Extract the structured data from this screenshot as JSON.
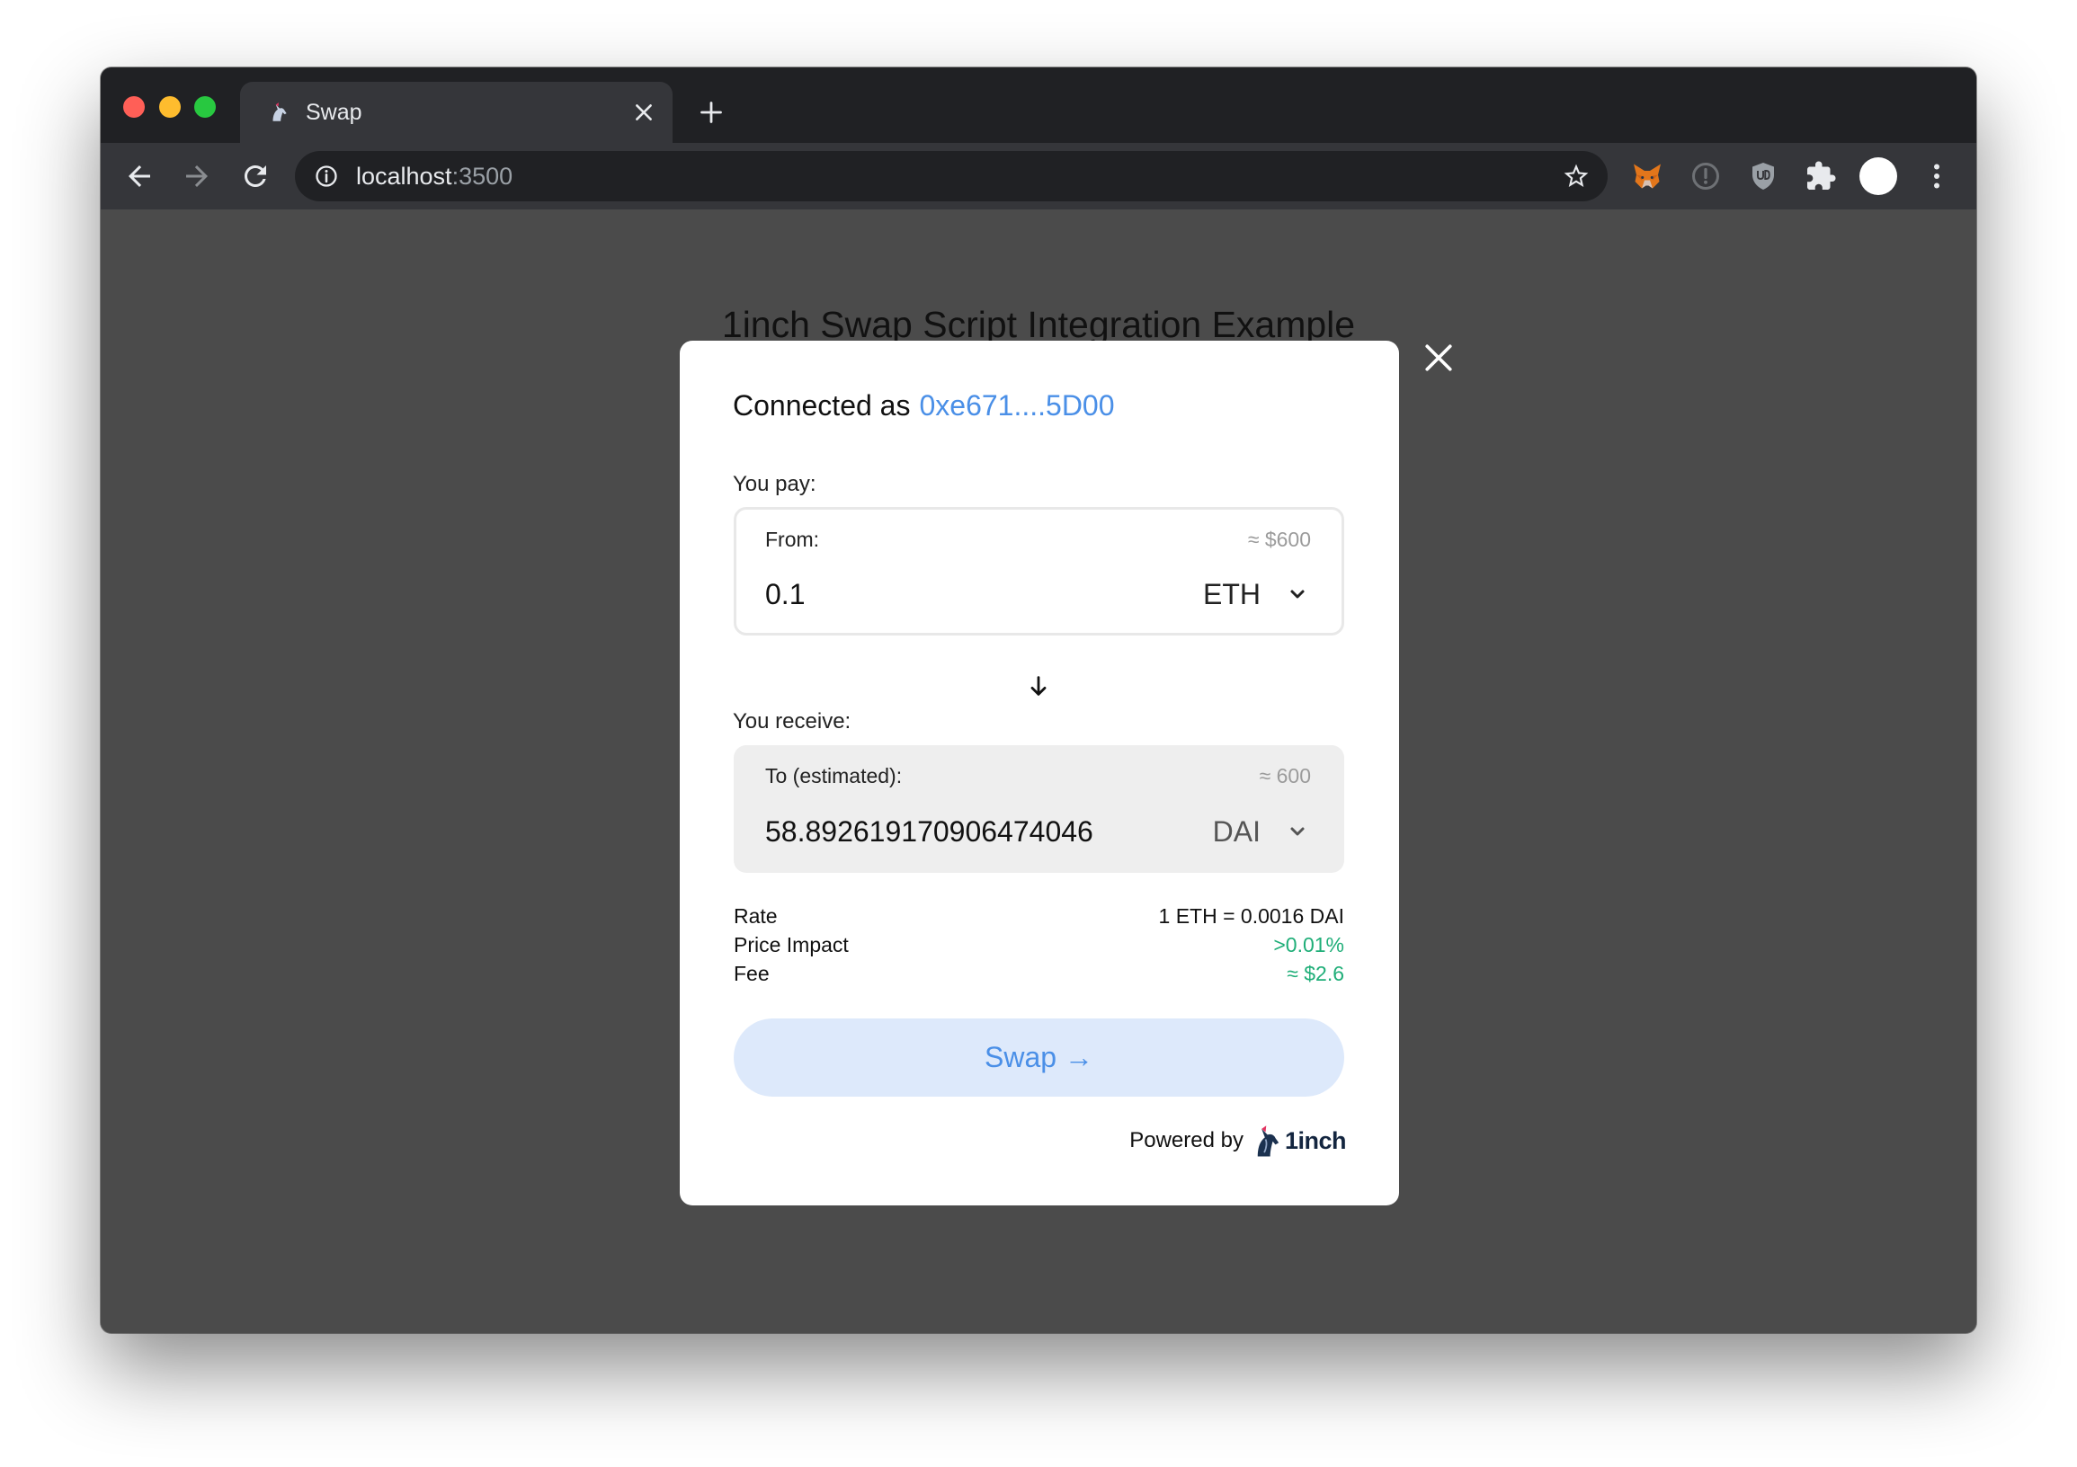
{
  "browser": {
    "tab": {
      "title": "Swap",
      "favicon": "1inch-unicorn-icon"
    },
    "address_bar": {
      "host": "localhost",
      "port": ":3500"
    },
    "extensions": [
      "metamask-icon",
      "info-icon",
      "ublock-shield-icon",
      "puzzle-extensions-icon",
      "profile-avatar",
      "kebab-menu-icon"
    ]
  },
  "page": {
    "heading": "1inch Swap Script Integration Example"
  },
  "modal": {
    "connected_label": "Connected as",
    "address": "0xe671....5D00",
    "pay_label": "You pay:",
    "from": {
      "label": "From:",
      "usd": "≈ $600",
      "amount": "0.1",
      "token": "ETH"
    },
    "receive_label": "You receive:",
    "to": {
      "label": "To (estimated):",
      "usd": "≈ 600",
      "amount": "58.892619170906474046",
      "token": "DAI"
    },
    "details": [
      {
        "label": "Rate",
        "value": "1 ETH = 0.0016 DAI"
      },
      {
        "label": "Price Impact",
        "value": ">0.01%"
      },
      {
        "label": "Fee",
        "value": "≈ $2.6"
      }
    ],
    "swap_button": "Swap →",
    "powered_by": "Powered by",
    "logo_text": "1inch"
  },
  "colors": {
    "accent-blue": "#4a8fe7",
    "positive-green": "#1fae78",
    "swap-button-bg": "#dde9fb",
    "overlay": "#4b4b4b"
  }
}
